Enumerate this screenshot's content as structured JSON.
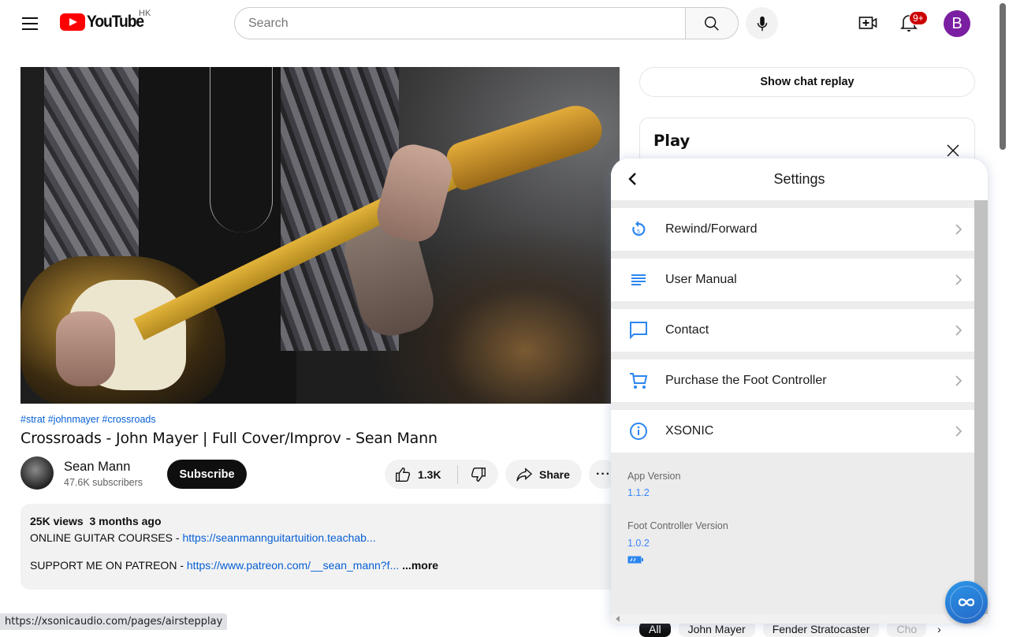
{
  "header": {
    "logo_text": "YouTube",
    "region": "HK",
    "search_placeholder": "Search",
    "search_value": "",
    "notifications_badge": "9+",
    "avatar_letter": "B"
  },
  "video": {
    "hashtags": "#strat #johnmayer #crossroads",
    "title": "Crossroads - John Mayer | Full Cover/Improv - Sean Mann",
    "channel_name": "Sean Mann",
    "channel_subscribers": "47.6K subscribers",
    "subscribe_label": "Subscribe",
    "like_count": "1.3K",
    "share_label": "Share",
    "more_actions_label": "···",
    "description": {
      "views": "25K views",
      "date": "3 months ago",
      "line1_text": "ONLINE GUITAR COURSES - ",
      "line1_link": "https://seanmannguitartuition.teachab...",
      "line2_text": "SUPPORT ME ON PATREON - ",
      "line2_link": "https://www.patreon.com/__sean_mann?f...",
      "more_label": "...more"
    }
  },
  "sidebar": {
    "chat_replay_label": "Show chat replay",
    "play_card_title": "Play",
    "chips": [
      "All",
      "John Mayer",
      "Fender Stratocaster",
      "Cho"
    ]
  },
  "settings_panel": {
    "title": "Settings",
    "items": [
      {
        "label": "Rewind/Forward",
        "icon": "rewind-5-icon"
      },
      {
        "label": "User Manual",
        "icon": "document-lines-icon"
      },
      {
        "label": "Contact",
        "icon": "chat-bubble-icon"
      },
      {
        "label": "Purchase the Foot Controller",
        "icon": "cart-icon"
      },
      {
        "label": "XSONIC",
        "icon": "info-icon"
      }
    ],
    "app_version_label": "App Version",
    "app_version": "1.1.2",
    "foot_controller_version_label": "Foot Controller Version",
    "foot_controller_version": "1.0.2",
    "battery_level": "low"
  },
  "status_bar": {
    "url": "https://xsonicaudio.com/pages/airstepplay"
  },
  "colors": {
    "accent_blue": "#3a86ff",
    "youtube_red": "#ff0000",
    "link_blue": "#065fd4",
    "avatar_purple": "#7b1fa2"
  }
}
